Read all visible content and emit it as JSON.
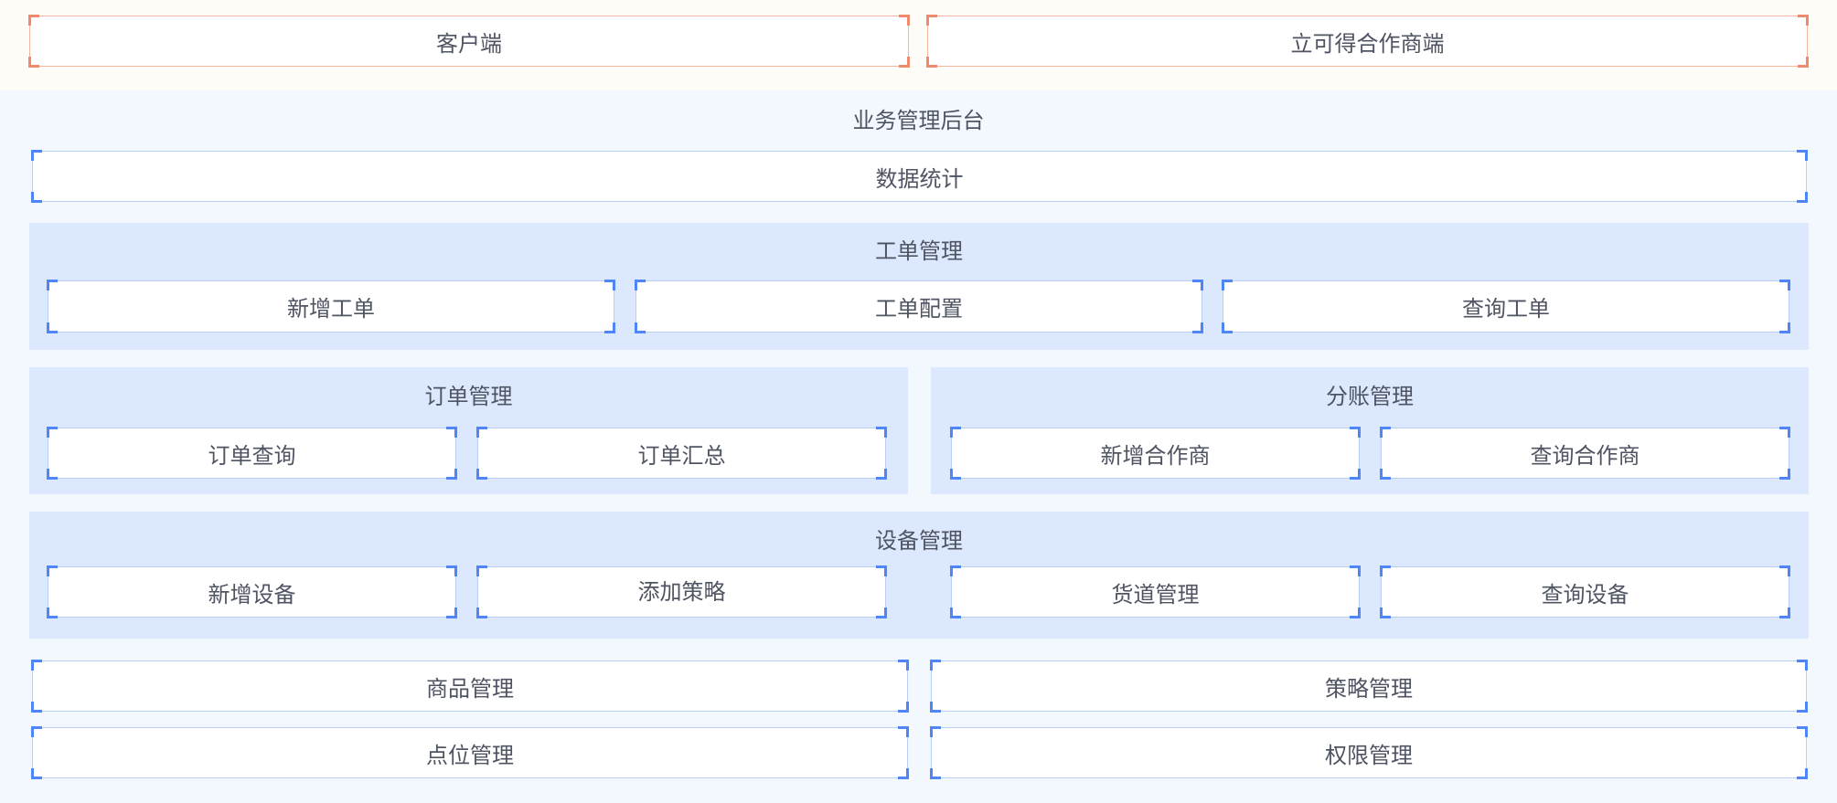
{
  "clients": {
    "customer": "客户端",
    "partner": "立可得合作商端"
  },
  "backend": {
    "title": "业务管理后台",
    "stats": "数据统计",
    "work_order": {
      "title": "工单管理",
      "items": [
        "新增工单",
        "工单配置",
        "查询工单"
      ]
    },
    "order": {
      "title": "订单管理",
      "items": [
        "订单查询",
        "订单汇总"
      ]
    },
    "split": {
      "title": "分账管理",
      "items": [
        "新增合作商",
        "查询合作商"
      ]
    },
    "device": {
      "title": "设备管理",
      "items": [
        "新增设备",
        "添加策略",
        "货道管理",
        "查询设备"
      ]
    },
    "product": "商品管理",
    "strategy": "策略管理",
    "location": "点位管理",
    "permission": "权限管理"
  },
  "colors": {
    "accent_blue": "#4f86f7",
    "accent_orange": "#f08a6c",
    "group_bg": "#dce8fd",
    "panel_bg": "#f3f7fe"
  }
}
